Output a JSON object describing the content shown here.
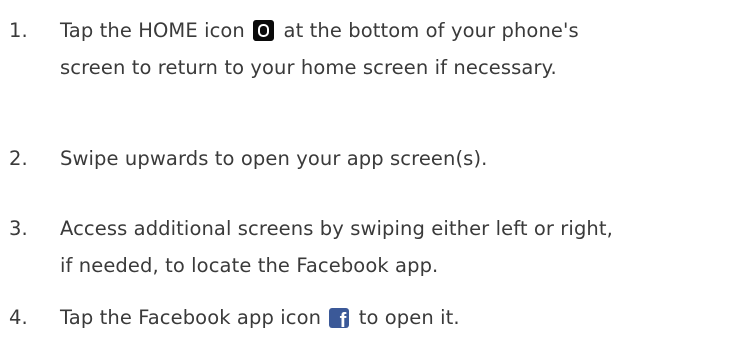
{
  "steps": [
    {
      "number": "1.",
      "line1_before_icon": "Tap the HOME icon",
      "line1_after_icon": "at the bottom of your phone's",
      "line2": "screen to return to your home screen if necessary.",
      "icon": "home-icon"
    },
    {
      "number": "2.",
      "line1": "Swipe upwards to open your app screen(s)."
    },
    {
      "number": "3.",
      "line1": "Access additional screens by swiping either left or right,",
      "line2": "if needed, to locate the Facebook app."
    },
    {
      "number": "4.",
      "line1_before_icon": "Tap the Facebook app icon",
      "line1_after_icon": "to open it.",
      "icon": "facebook-icon"
    }
  ],
  "colors": {
    "text": "#3a3a3a",
    "home_icon_bg": "#0a0a0a",
    "facebook_blue": "#3b5998"
  }
}
